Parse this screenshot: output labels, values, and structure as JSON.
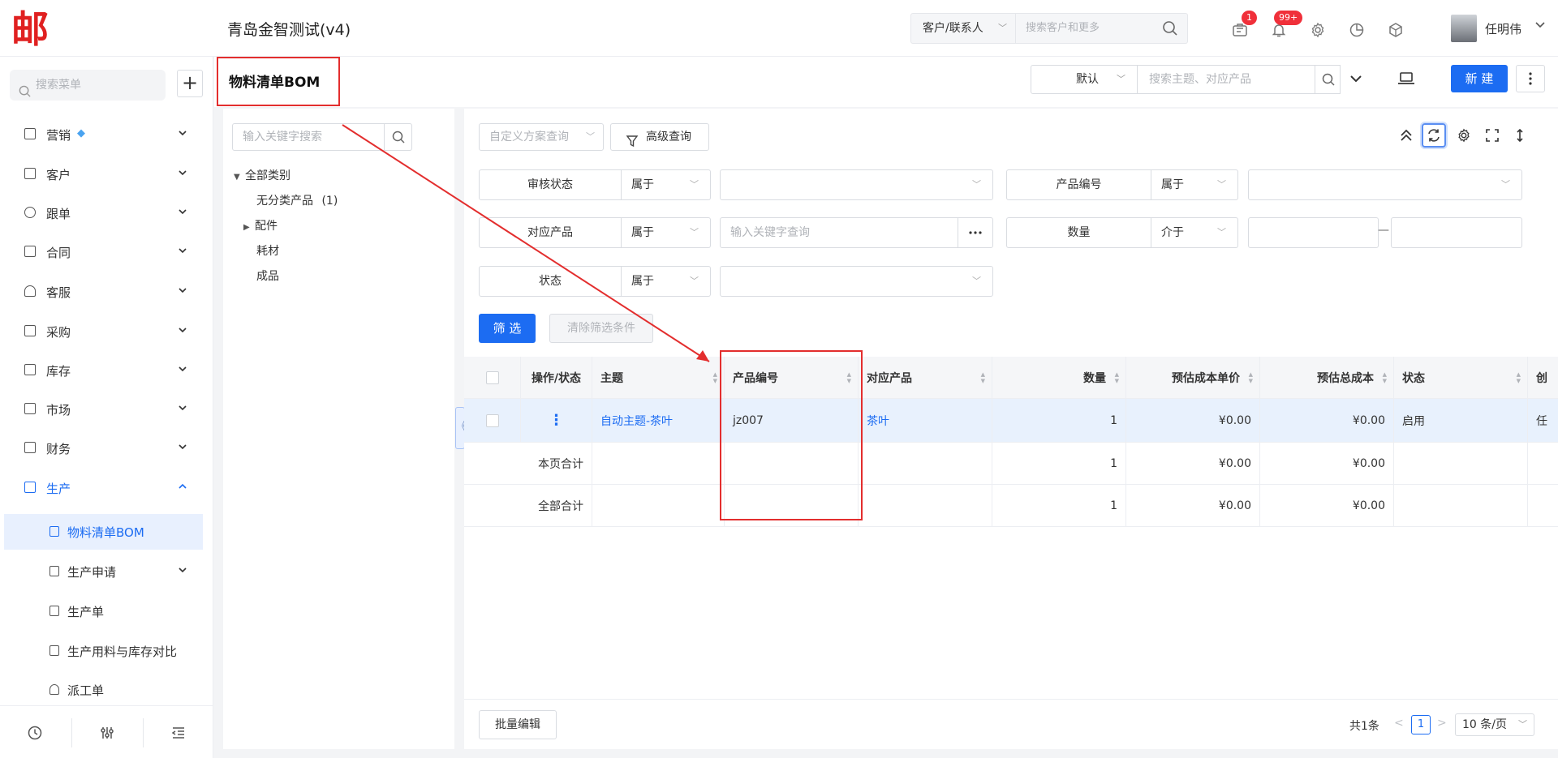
{
  "header": {
    "logo_text": "邮",
    "app_title": "青岛金智测试(v4)",
    "search_type": "客户/联系人",
    "search_placeholder": "搜索客户和更多",
    "notify_badge_1": "1",
    "notify_badge_2": "99+",
    "user_name": "任明伟"
  },
  "sidebar": {
    "search_placeholder": "搜索菜单",
    "add_label": "+",
    "items": [
      {
        "label": "营销"
      },
      {
        "label": "客户"
      },
      {
        "label": "跟单"
      },
      {
        "label": "合同"
      },
      {
        "label": "客服"
      },
      {
        "label": "采购"
      },
      {
        "label": "库存"
      },
      {
        "label": "市场"
      },
      {
        "label": "财务"
      },
      {
        "label": "生产"
      }
    ],
    "sub_items": [
      {
        "label": "物料清单BOM"
      },
      {
        "label": "生产申请"
      },
      {
        "label": "生产单"
      },
      {
        "label": "生产用料与库存对比"
      },
      {
        "label": "派工单"
      }
    ]
  },
  "page": {
    "title": "物料清单BOM",
    "view_select": "默认",
    "search_placeholder": "搜索主题、对应产品",
    "new_button": "新 建"
  },
  "tree": {
    "search_placeholder": "输入关键字搜索",
    "nodes": [
      {
        "label": "全部类别"
      },
      {
        "label": "无分类产品",
        "count": "(1)"
      },
      {
        "label": "配件"
      },
      {
        "label": "耗材"
      },
      {
        "label": "成品"
      }
    ],
    "collapse_label": "《"
  },
  "filters": {
    "custom_query_placeholder": "自定义方案查询",
    "advanced_query": "高级查询",
    "rows": [
      {
        "label": "审核状态",
        "op": "属于"
      },
      {
        "label": "产品编号",
        "op": "属于"
      },
      {
        "label": "对应产品",
        "op": "属于",
        "placeholder": "输入关键字查询"
      },
      {
        "label": "数量",
        "op": "介于"
      },
      {
        "label": "状态",
        "op": "属于"
      }
    ],
    "range_separator": "—",
    "filter_button": "筛 选",
    "clear_button": "清除筛选条件"
  },
  "table": {
    "columns": [
      "操作/状态",
      "主题",
      "产品编号",
      "对应产品",
      "数量",
      "预估成本单价",
      "预估总成本",
      "状态",
      "创"
    ],
    "rows": [
      {
        "action": "⋮",
        "subject": "自动主题-茶叶",
        "code": "jz007",
        "product": "茶叶",
        "qty": "1",
        "unit_cost": "¥0.00",
        "total_cost": "¥0.00",
        "status": "启用",
        "creator": "任"
      }
    ],
    "page_total": {
      "label": "本页合计",
      "qty": "1",
      "unit_cost": "¥0.00",
      "total_cost": "¥0.00"
    },
    "all_total": {
      "label": "全部合计",
      "qty": "1",
      "unit_cost": "¥0.00",
      "total_cost": "¥0.00"
    }
  },
  "footer": {
    "batch_edit": "批量编辑",
    "total": "共1条",
    "current_page": "1",
    "page_size": "10 条/页"
  },
  "colors": {
    "accent": "#1c6cf2",
    "annotation": "#e32e2e",
    "badge": "#f0303a"
  }
}
